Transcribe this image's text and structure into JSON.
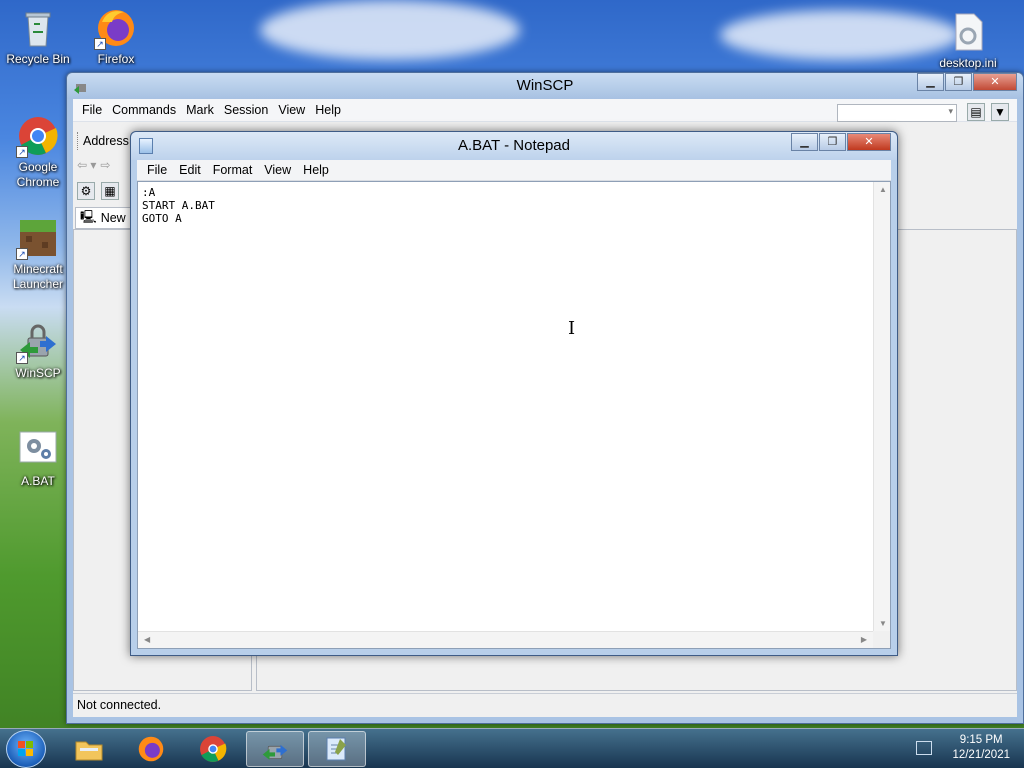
{
  "desktop": {
    "icons": [
      {
        "label": "Recycle Bin",
        "icon": "recycle-bin-icon"
      },
      {
        "label": "Firefox",
        "icon": "firefox-icon"
      },
      {
        "label": "desktop.ini",
        "icon": "config-file-icon"
      },
      {
        "label": "Google Chrome",
        "icon": "chrome-icon"
      },
      {
        "label": "Minecraft Launcher",
        "icon": "minecraft-icon"
      },
      {
        "label": "WinSCP",
        "icon": "winscp-icon"
      },
      {
        "label": "A.BAT",
        "icon": "batch-file-icon"
      }
    ]
  },
  "winscp": {
    "title": "WinSCP",
    "menu": [
      "File",
      "Commands",
      "Mark",
      "Session",
      "View",
      "Help"
    ],
    "address_label": "Address",
    "session_tab": "New",
    "status": "Not connected."
  },
  "notepad": {
    "title": "A.BAT - Notepad",
    "menu": [
      "File",
      "Edit",
      "Format",
      "View",
      "Help"
    ],
    "content": ":A\nSTART A.BAT\nGOTO A"
  },
  "taskbar": {
    "items": [
      {
        "name": "explorer",
        "icon": "folder-icon"
      },
      {
        "name": "firefox",
        "icon": "firefox-icon"
      },
      {
        "name": "chrome",
        "icon": "chrome-icon"
      },
      {
        "name": "winscp",
        "icon": "winscp-icon"
      },
      {
        "name": "notepad",
        "icon": "notepad-icon"
      }
    ],
    "time": "9:15 PM",
    "date": "12/21/2021"
  },
  "colors": {
    "accent": "#1c5fb8",
    "close_button": "#c0391f"
  }
}
